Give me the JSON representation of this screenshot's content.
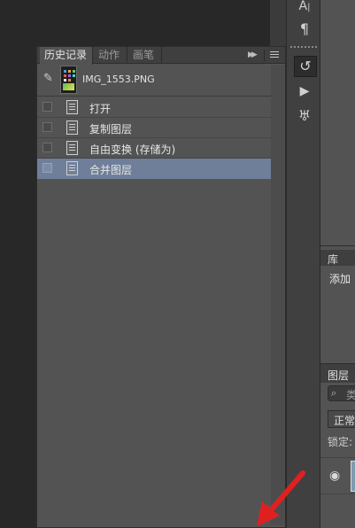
{
  "history_panel": {
    "tabs": [
      {
        "label": "历史记录",
        "active": true
      },
      {
        "label": "动作",
        "active": false
      },
      {
        "label": "画笔",
        "active": false
      }
    ],
    "collapse_icon": "double-chevron-right-icon",
    "menu_icon": "panel-menu-icon",
    "snapshot": {
      "label": "IMG_1553.PNG",
      "icon": "history-brush-source-icon"
    },
    "states": [
      {
        "label": "打开",
        "selected": false
      },
      {
        "label": "复制图层",
        "selected": false
      },
      {
        "label": "自由变换 (存储为)",
        "selected": false
      },
      {
        "label": "合并图层",
        "selected": true
      }
    ],
    "selected_color": "#6f7f99"
  },
  "toolbar": {
    "items": [
      {
        "name": "character-icon",
        "glyph": "A|"
      },
      {
        "name": "paragraph-icon",
        "glyph": "¶"
      },
      {
        "name": "history-icon",
        "glyph": "↺"
      },
      {
        "name": "actions-play-icon",
        "glyph": "▶"
      },
      {
        "name": "brush-presets-icon",
        "glyph": "♅"
      }
    ]
  },
  "right_panel": {
    "library_tab": "库",
    "library_add": "添加",
    "layers_tab": "图层",
    "search_placeholder": "类",
    "blend_mode": "正常",
    "lock_label": "锁定:"
  },
  "annotation": {
    "arrow_color": "#e02020"
  }
}
